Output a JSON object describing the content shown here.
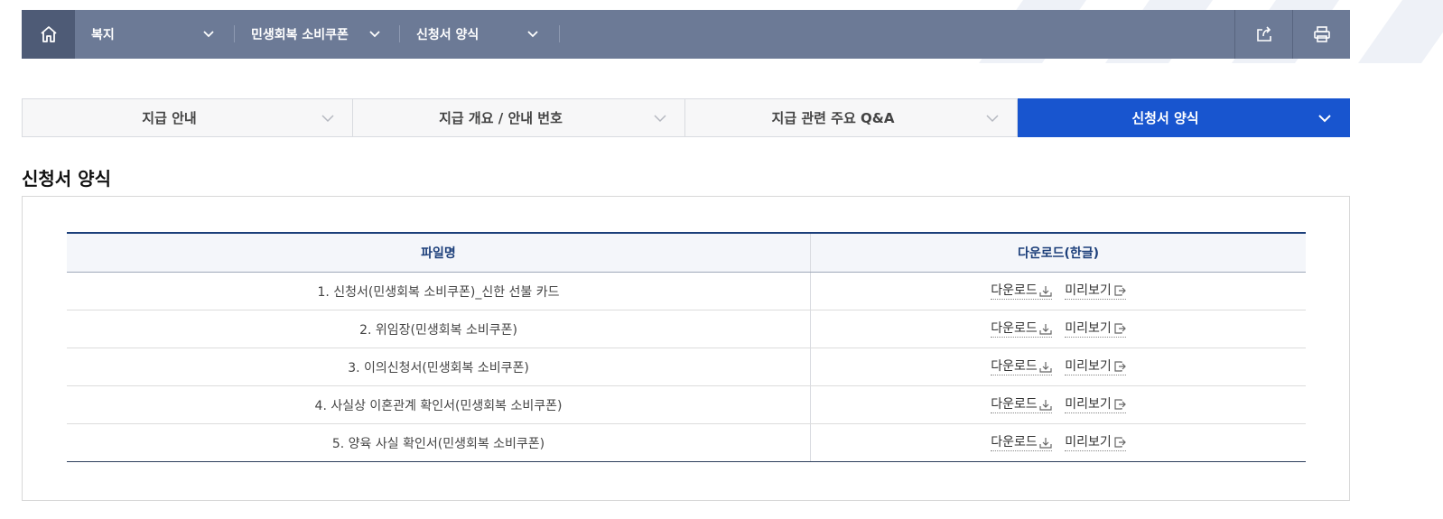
{
  "breadcrumb": {
    "home_icon": "home-icon",
    "items": [
      {
        "label": "복지"
      },
      {
        "label": "민생회복 소비쿠폰"
      },
      {
        "label": "신청서 양식"
      }
    ],
    "share_icon": "share-icon",
    "print_icon": "print-icon"
  },
  "tabs": [
    {
      "label": "지급 안내",
      "active": false
    },
    {
      "label": "지급 개요 / 안내 번호",
      "active": false
    },
    {
      "label": "지급 관련 주요 Q&A",
      "active": false
    },
    {
      "label": "신청서 양식",
      "active": true
    }
  ],
  "section_title": "신청서 양식",
  "table": {
    "headers": {
      "file_name": "파일명",
      "download": "다운로드(한글)"
    },
    "rows": [
      {
        "file": "1. 신청서(민생회복 소비쿠폰)_신한 선불 카드",
        "download": "다운로드",
        "preview": "미리보기"
      },
      {
        "file": "2. 위임장(민생회복 소비쿠폰)",
        "download": "다운로드",
        "preview": "미리보기"
      },
      {
        "file": "3. 이의신청서(민생회복 소비쿠폰)",
        "download": "다운로드",
        "preview": "미리보기"
      },
      {
        "file": "4. 사실상 이혼관계 확인서(민생회복 소비쿠폰)",
        "download": "다운로드",
        "preview": "미리보기"
      },
      {
        "file": "5. 양육 사실 확인서(민생회복 소비쿠폰)",
        "download": "다운로드",
        "preview": "미리보기"
      }
    ]
  },
  "colors": {
    "topbar": "#6c7a96",
    "home_bg": "#4e5b76",
    "active_tab": "#1855cf",
    "header_text": "#1c3f7a"
  }
}
